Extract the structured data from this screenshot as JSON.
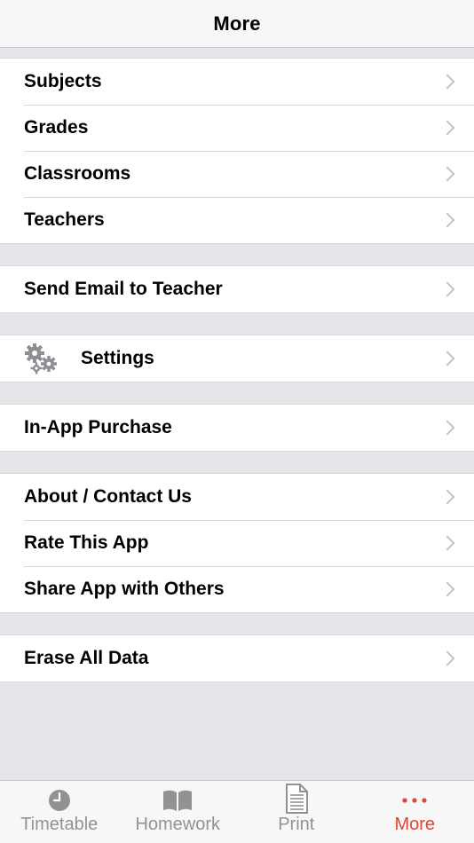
{
  "navbar": {
    "title": "More"
  },
  "groups": [
    {
      "items": [
        {
          "label": "Subjects"
        },
        {
          "label": "Grades"
        },
        {
          "label": "Classrooms"
        },
        {
          "label": "Teachers"
        }
      ]
    },
    {
      "items": [
        {
          "label": "Send Email to Teacher"
        }
      ]
    },
    {
      "items": [
        {
          "label": "Settings",
          "icon": "gears-icon"
        }
      ]
    },
    {
      "items": [
        {
          "label": "In-App Purchase"
        }
      ]
    },
    {
      "items": [
        {
          "label": "About / Contact Us"
        },
        {
          "label": "Rate This App"
        },
        {
          "label": "Share App with Others"
        }
      ]
    },
    {
      "items": [
        {
          "label": "Erase All Data"
        }
      ]
    }
  ],
  "tabbar": {
    "tabs": [
      {
        "label": "Timetable",
        "icon": "clock-icon"
      },
      {
        "label": "Homework",
        "icon": "book-icon"
      },
      {
        "label": "Print",
        "icon": "document-icon"
      },
      {
        "label": "More",
        "icon": "more-dots-icon",
        "active": true
      }
    ]
  },
  "colors": {
    "accent": "#e0443a",
    "tab_inactive": "#929292",
    "background": "#e5e5ea"
  }
}
